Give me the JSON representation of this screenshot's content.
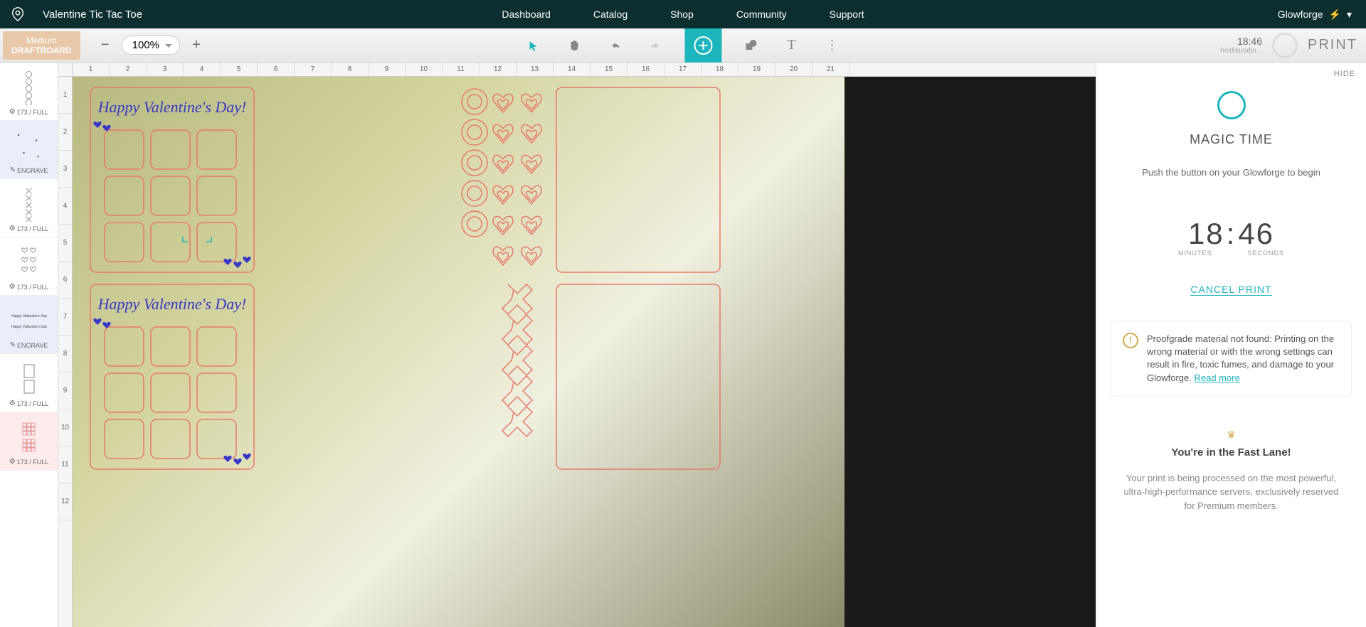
{
  "header": {
    "project_title": "Valentine Tic Tac Toe",
    "nav": [
      "Dashboard",
      "Catalog",
      "Shop",
      "Community",
      "Support"
    ],
    "user": "Glowforge",
    "bolt": "⚡"
  },
  "toolbar": {
    "material_line1": "Medium",
    "material_line2": "DRAFTBOARD",
    "zoom": "100%",
    "print_time": "18:46",
    "print_user": "heidikundin...",
    "print_label": "PRINT"
  },
  "steps": [
    {
      "type": "oooo",
      "label": "173 / FULL"
    },
    {
      "type": "dots",
      "label": "ENGRAVE",
      "selected": true
    },
    {
      "type": "xxxx",
      "label": "173 / FULL"
    },
    {
      "type": "hearts",
      "label": "173 / FULL"
    },
    {
      "type": "text",
      "label": "ENGRAVE",
      "selected": true
    },
    {
      "type": "rect",
      "label": "173 / FULL"
    },
    {
      "type": "grid",
      "label": "173 / FULL",
      "cutred": true
    }
  ],
  "ruler_h": [
    "1",
    "2",
    "3",
    "4",
    "5",
    "6",
    "7",
    "8",
    "9",
    "10",
    "11",
    "12",
    "13",
    "14",
    "15",
    "16",
    "17",
    "18",
    "19",
    "20",
    "21"
  ],
  "ruler_v": [
    "1",
    "2",
    "3",
    "4",
    "5",
    "6",
    "7",
    "8",
    "9",
    "10",
    "11",
    "12"
  ],
  "design_text": "Happy Valentine's Day!",
  "right_panel": {
    "hide": "HIDE",
    "magic_title": "MAGIC TIME",
    "magic_sub": "Push the button on your Glowforge to begin",
    "minutes": "18",
    "seconds": "46",
    "min_label": "MINUTES",
    "sec_label": "SECONDS",
    "cancel": "CANCEL PRINT",
    "warning": "Proofgrade material not found: Printing on the wrong material or with the wrong settings can result in fire, toxic fumes, and damage to your Glowforge. ",
    "read_more": "Read more",
    "fast_title": "You're in the Fast Lane!",
    "fast_desc": "Your print is being processed on the most powerful, ultra-high-performance servers, exclusively reserved for Premium members."
  }
}
